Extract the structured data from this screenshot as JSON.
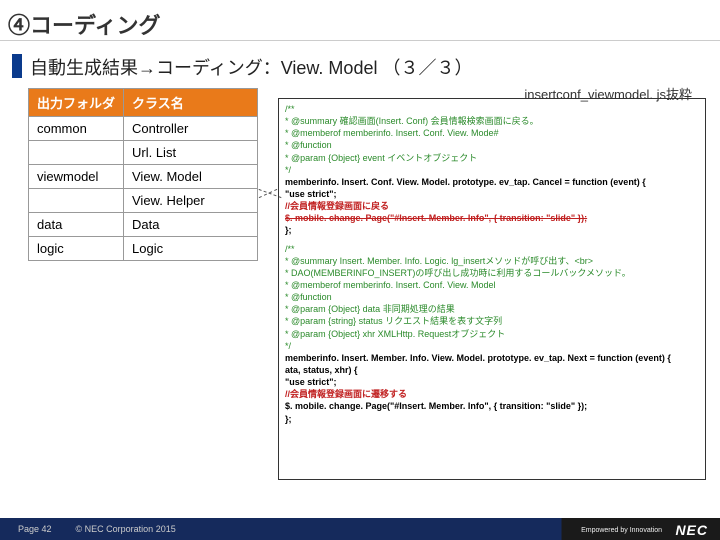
{
  "title": "④コーディング",
  "subtitle": "自動生成結果→コーディング：View. Model （３／３）",
  "code_caption": "insertconf_viewmodel. js抜粋",
  "table": {
    "h1": "出力フォルダ",
    "h2": "クラス名",
    "rows": [
      [
        "common",
        "Controller"
      ],
      [
        "",
        "Url. List"
      ],
      [
        "viewmodel",
        "View. Model"
      ],
      [
        "",
        "View. Helper"
      ],
      [
        "data",
        "Data"
      ],
      [
        "logic",
        "Logic"
      ]
    ]
  },
  "code": {
    "c1l1": "/**",
    "c1l2": " * @summary 確認画面(Insert. Conf) 会員情報検索画面に戻る。",
    "c1l3": " * @memberof memberinfo. Insert. Conf. View. Mode#",
    "c1l4": " * @function",
    "c1l5": " * @param {Object} event イベントオブジェクト",
    "c1l6": " */",
    "b1l1": "memberinfo. Insert. Conf. View. Model. prototype. ev_tap. Cancel = function (event) {",
    "b1l2": "  \"use strict\";",
    "b1l3": "  //会員情報登録画面に戻る",
    "b1l4": "  $. mobile. change. Page(\"#Insert. Member. Info\", { transition: \"slide\" });",
    "b1l5": "};",
    "c2l1": "/**",
    "c2l2": " * @summary Insert. Member. Info. Logic. lg_insertメソッドが呼び出す、<br>",
    "c2l3": " *     DAO(MEMBERINFO_INSERT)の呼び出し成功時に利用するコールバックメソッド。",
    "c2l4": " * @memberof memberinfo. Insert. Conf. View. Model",
    "c2l5": " * @function",
    "c2l6": " * @param {Object} data 非同期処理の結果",
    "c2l7": " * @param {string} status リクエスト結果を表す文字列",
    "c2l8": " * @param {Object} xhr XMLHttp. Requestオブジェクト",
    "c2l9": " */",
    "b2l1": "memberinfo. Insert. Member. Info. View. Model. prototype. ev_tap. Next = function (event) {",
    "b2l2": "ata, status, xhr) {",
    "b2l3": "  \"use strict\";",
    "b2l4": "  //会員情報登録画面に遷移する",
    "b2l5": "  $. mobile. change. Page(\"#Insert. Member. Info\", { transition: \"slide\" });",
    "b2l6": "};"
  },
  "footer": {
    "page": "Page 42",
    "copyright": "© NEC Corporation 2015",
    "tagline": "Empowered by Innovation",
    "brand": "NEC"
  }
}
